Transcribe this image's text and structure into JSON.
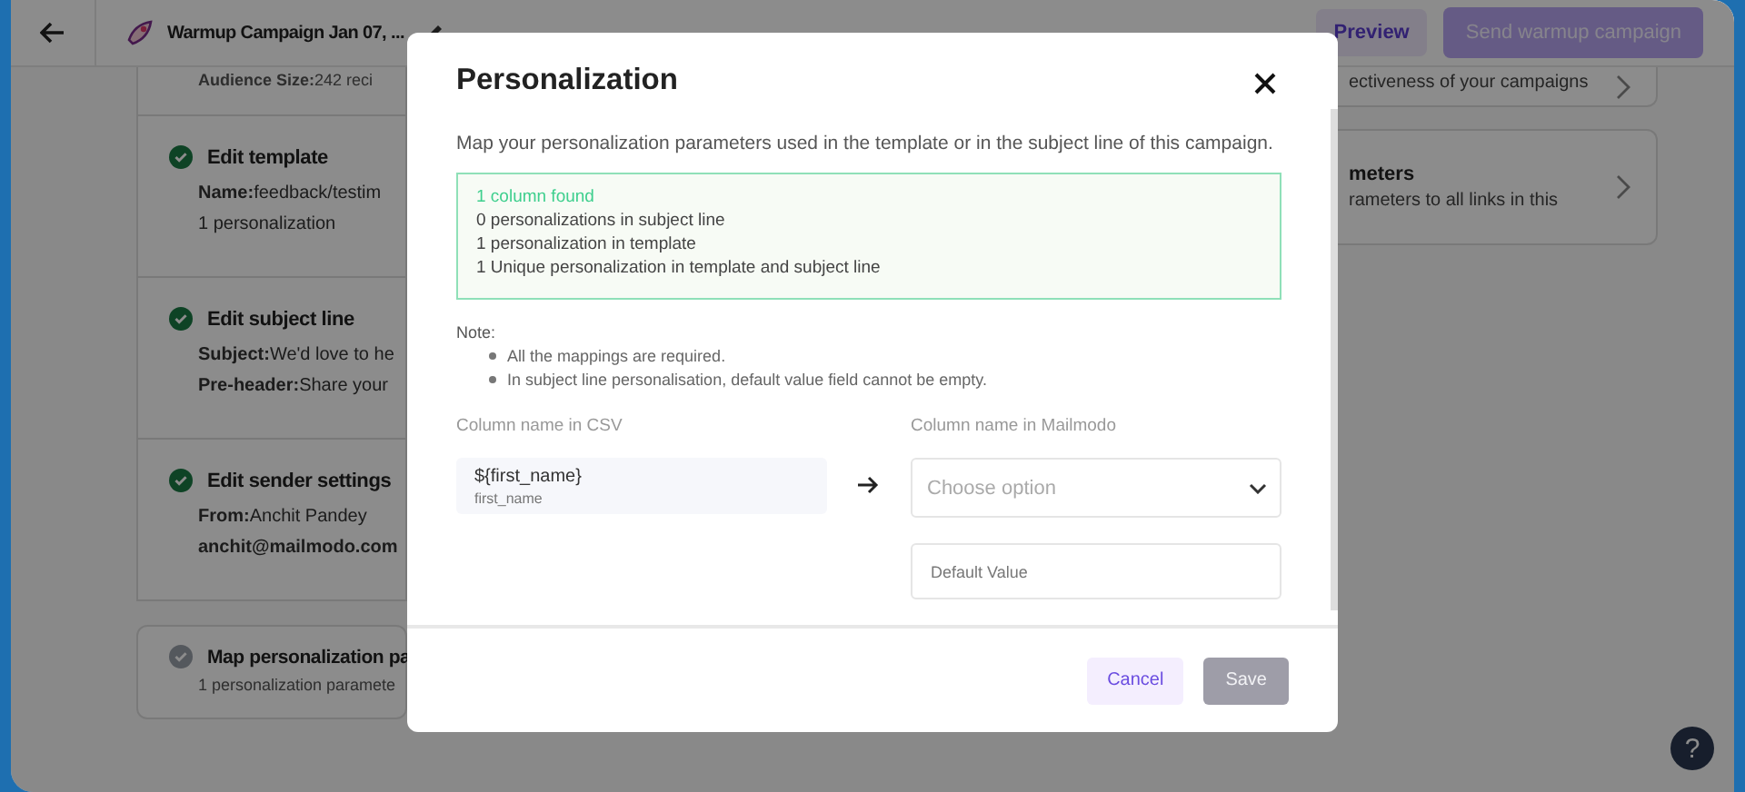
{
  "header": {
    "title": "Warmup Campaign Jan 07, ...",
    "preview": "Preview",
    "send": "Send warmup campaign"
  },
  "steps": [
    {
      "lines": [
        {
          "label": "Audience Size:",
          "value": "242 reci"
        }
      ]
    },
    {
      "title": "Edit template",
      "done": true,
      "lines": [
        {
          "label": "Name:",
          "value": "feedback/testim"
        },
        {
          "value": "1 personalization"
        }
      ]
    },
    {
      "title": "Edit subject line",
      "done": true,
      "lines": [
        {
          "label": "Subject:",
          "value": "We'd love to he"
        },
        {
          "label": "Pre-header:",
          "value": "Share your"
        }
      ]
    },
    {
      "title": "Edit sender settings",
      "done": true,
      "lines": [
        {
          "label": "From:",
          "value": "Anchit Pandey"
        },
        {
          "label": "anchit@mailmodo.com"
        }
      ]
    },
    {
      "title": "Map personalization pa",
      "done": false,
      "lines": [
        {
          "value": "1 personalization paramete"
        }
      ]
    }
  ],
  "side_cards": [
    {
      "text": "ectiveness of your campaigns"
    },
    {
      "title": "meters",
      "text": "rameters to all links in this"
    }
  ],
  "modal": {
    "title": "Personalization",
    "description": "Map your personalization parameters used in the template or in the subject line of this campaign.",
    "summary": {
      "headline": "1 column found",
      "lines": [
        "0 personalizations in subject line",
        "1 personalization in template",
        "1 Unique personalization in template and subject line"
      ]
    },
    "note": {
      "label": "Note:",
      "items": [
        "All the mappings are required.",
        "In subject line personalisation, default value field cannot be empty."
      ]
    },
    "csv_label": "Column name in CSV",
    "mailmodo_label": "Column name in Mailmodo",
    "rows": [
      {
        "variable": "${first_name}",
        "column": "first_name",
        "select_placeholder": "Choose option",
        "default_placeholder": "Default Value"
      }
    ],
    "cancel": "Cancel",
    "save": {
      "label": "Save",
      "disabled": true
    }
  },
  "help": "?"
}
